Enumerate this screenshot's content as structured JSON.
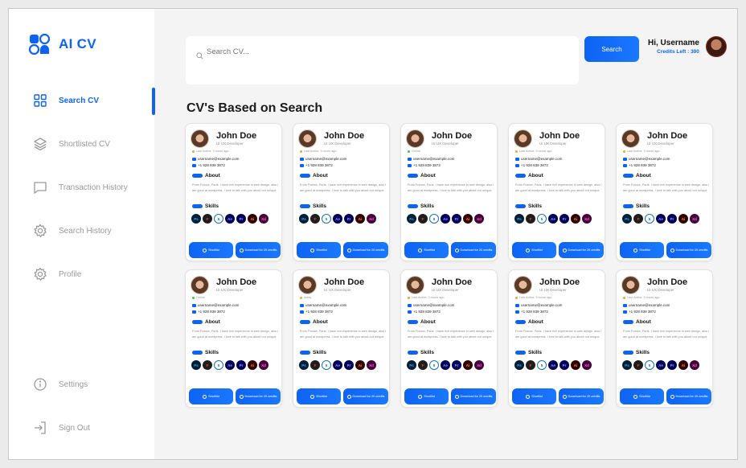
{
  "app": {
    "name": "AI CV"
  },
  "sidebar": {
    "items": [
      {
        "id": "search-cv",
        "label": "Search CV",
        "icon": "grid-icon",
        "active": true
      },
      {
        "id": "shortlisted-cv",
        "label": "Shortlisted CV",
        "icon": "layers-icon",
        "active": false
      },
      {
        "id": "transaction-history",
        "label": "Transaction History",
        "icon": "chat-icon",
        "active": false
      },
      {
        "id": "search-history",
        "label": "Search History",
        "icon": "gear-icon",
        "active": false
      },
      {
        "id": "profile",
        "label": "Profile",
        "icon": "gear-icon",
        "active": false
      }
    ],
    "bottom": [
      {
        "id": "settings",
        "label": "Settings",
        "icon": "info-icon"
      },
      {
        "id": "sign-out",
        "label": "Sign Out",
        "icon": "sign-out-icon"
      }
    ]
  },
  "search": {
    "placeholder": "Search CV...",
    "button_label": "Search"
  },
  "user": {
    "greeting": "Hi, Username",
    "credits": "Credits Left : 300"
  },
  "main": {
    "title": "CV's Based on Search"
  },
  "colors": {
    "accent": "#0e63f4",
    "background": "#f4f4f4"
  },
  "card_template": {
    "email": "username@example.com",
    "phone": "+1 928 839 3872",
    "about_heading": "About",
    "about_text": "From France, Paris. I have rich experience in web design, also I am good at wordpress. I love to talk with you about our unique.",
    "skills_heading": "Skills",
    "shortlist_label": "Shortlist",
    "download_label": "Download for 20 credits"
  },
  "skills": [
    {
      "abbr": "Ps",
      "name": "photoshop-icon",
      "bg": "#001e36",
      "fg": "#31a8ff"
    },
    {
      "abbr": "F",
      "name": "figma-icon",
      "bg": "#1e1e1e",
      "fg": "#f24e1e"
    },
    {
      "abbr": "5",
      "name": "css3-icon",
      "bg": "#ffffff",
      "fg": "#1572b6"
    },
    {
      "abbr": "Ae",
      "name": "after-effects-icon",
      "bg": "#00005b",
      "fg": "#9999ff"
    },
    {
      "abbr": "Pr",
      "name": "premiere-icon",
      "bg": "#00005b",
      "fg": "#9999ff"
    },
    {
      "abbr": "Ai",
      "name": "illustrator-icon",
      "bg": "#330000",
      "fg": "#ff9a00"
    },
    {
      "abbr": "Xd",
      "name": "xd-icon",
      "bg": "#470137",
      "fg": "#ff61f6"
    }
  ],
  "cards": [
    {
      "name": "John Doe",
      "role": "UI UX Developer",
      "status": "Last Active: 3 hours ago",
      "status_color": "#f5a623"
    },
    {
      "name": "John Doe",
      "role": "UI UX Developer",
      "status": "Last Active: 3 hours ago",
      "status_color": "#f5a623"
    },
    {
      "name": "John Doe",
      "role": "UI UX Developer",
      "status": "Online",
      "status_color": "#3cc25a"
    },
    {
      "name": "John Doe",
      "role": "UI UX Developer",
      "status": "Last Active: 3 hours ago",
      "status_color": "#f5a623"
    },
    {
      "name": "John Doe",
      "role": "UI UX Developer",
      "status": "Last Active: 3 hours ago",
      "status_color": "#f5a623"
    },
    {
      "name": "John Doe",
      "role": "UI UX Developer",
      "status": "Online",
      "status_color": "#3cc25a"
    },
    {
      "name": "John Doe",
      "role": "UI UX Developer",
      "status": "Away",
      "status_color": "#f5a623"
    },
    {
      "name": "John Doe",
      "role": "UI UX Developer",
      "status": "Last Active: 3 hours ago",
      "status_color": "#f5a623"
    },
    {
      "name": "John Doe",
      "role": "UI UX Developer",
      "status": "Last Active: 3 hours ago",
      "status_color": "#f5a623"
    },
    {
      "name": "John Doe",
      "role": "UI UX Developer",
      "status": "Last Active: 3 hours ago",
      "status_color": "#f5a623"
    }
  ]
}
